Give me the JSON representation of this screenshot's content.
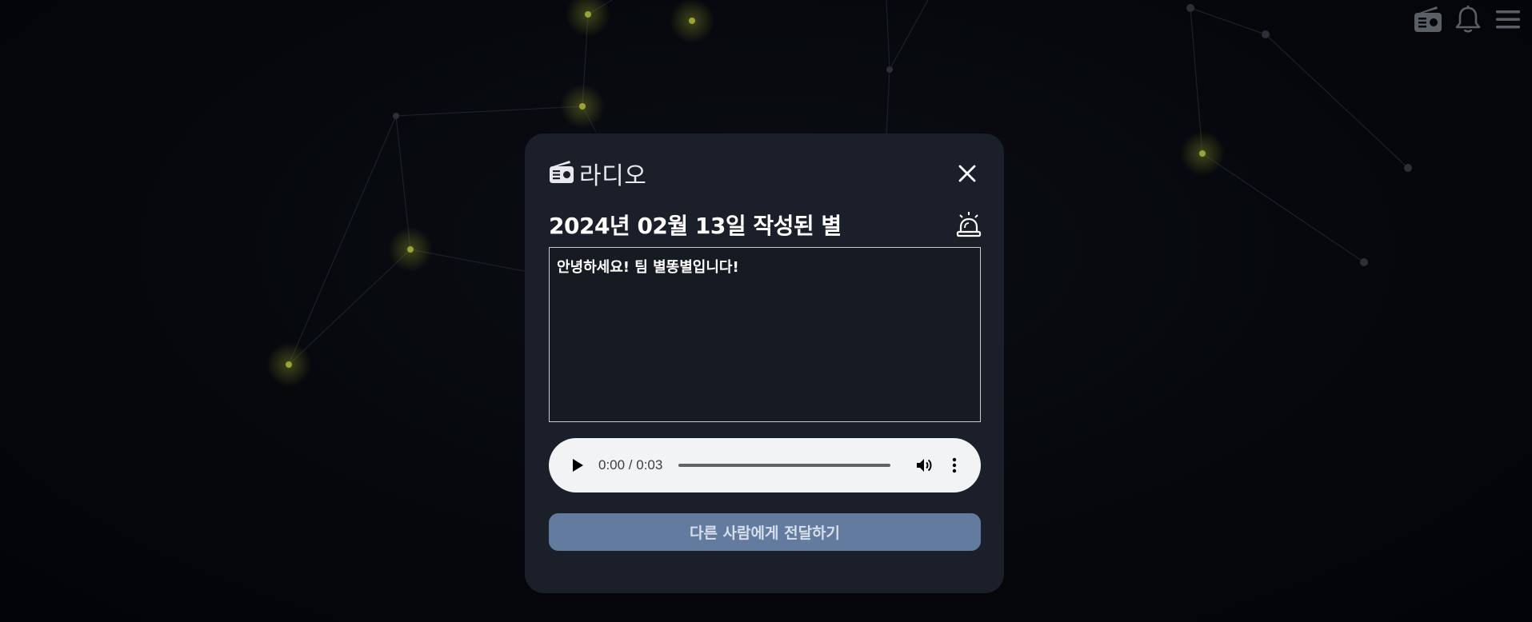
{
  "header": {
    "icons": [
      "radio-icon",
      "bell-icon",
      "menu-icon"
    ]
  },
  "modal": {
    "title": "라디오",
    "title_icon": "radio-icon",
    "date_heading": "2024년 02월 13일 작성된 별",
    "alarm_icon": "siren-icon",
    "message": "안녕하세요! 팀 별똥별입니다!",
    "audio": {
      "time": "0:00 / 0:03",
      "progress": 0
    },
    "forward_label": "다른 사람에게 전달하기"
  },
  "colors": {
    "background": "#05070b",
    "modal": "#1b1f29",
    "star": "#9aa33a",
    "button": "#647ba0",
    "button_text": "#d6deea"
  }
}
